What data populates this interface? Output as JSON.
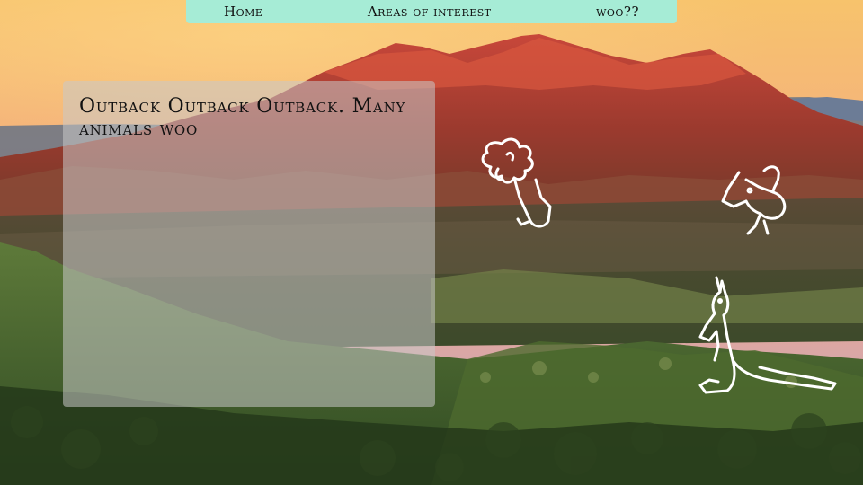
{
  "nav": {
    "home": "Home",
    "areas": "Areas of interest",
    "woo": "woo??"
  },
  "panel": {
    "text": "Outback Outback Outback. Many animals woo"
  },
  "icons": {
    "animal_1": "koala-icon",
    "animal_2": "platypus-icon",
    "animal_3": "kangaroo-icon"
  },
  "colors": {
    "nav_bg": "#a6ecd6",
    "panel_bg": "rgba(200,200,200,0.55)",
    "line_art": "#ffffff"
  }
}
